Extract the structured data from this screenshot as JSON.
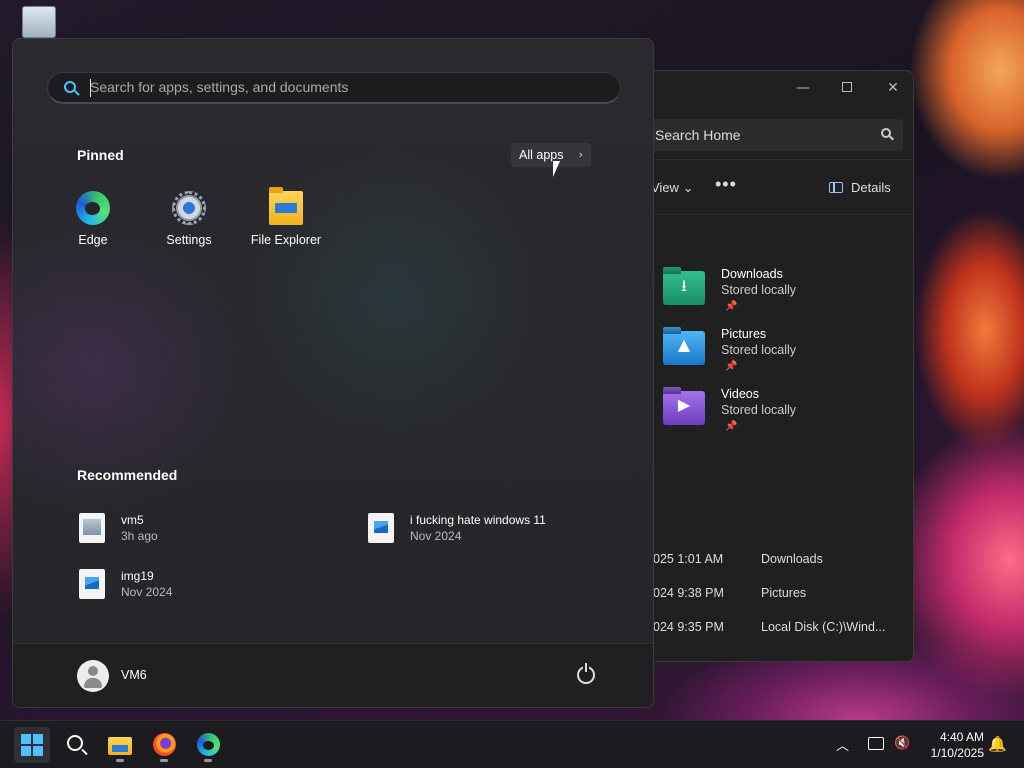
{
  "desktop": {
    "recycle_bin_icon": "recycle-bin-icon"
  },
  "start_menu": {
    "search_placeholder": "Search for apps, settings, and documents",
    "pinned_title": "Pinned",
    "all_apps_label": "All apps",
    "pinned_apps": [
      {
        "label": "Edge",
        "icon": "edge-icon"
      },
      {
        "label": "Settings",
        "icon": "settings-gear-icon"
      },
      {
        "label": "File Explorer",
        "icon": "folder-icon"
      }
    ],
    "recommended_title": "Recommended",
    "recommended": [
      {
        "name": "vm5",
        "time": "3h ago",
        "icon": "vm-file-icon"
      },
      {
        "name": "i fucking hate windows 11",
        "time": "Nov 2024",
        "icon": "image-file-icon"
      },
      {
        "name": "img19",
        "time": "Nov 2024",
        "icon": "image-file-icon"
      }
    ],
    "user_name": "VM6"
  },
  "explorer": {
    "window_controls": {
      "minimize": "—",
      "close": "✕"
    },
    "search_placeholder": "Search Home",
    "toolbar": {
      "view_label": "View",
      "details_label": "Details"
    },
    "quick_access": [
      {
        "name": "Downloads",
        "status": "Stored locally",
        "icon": "downloads-folder-icon",
        "glyph": "⭳"
      },
      {
        "name": "Pictures",
        "status": "Stored locally",
        "icon": "pictures-folder-icon",
        "glyph": "▲"
      },
      {
        "name": "Videos",
        "status": "Stored locally",
        "icon": "videos-folder-icon",
        "glyph": "▶"
      }
    ],
    "recent": [
      {
        "date": "025 1:01 AM",
        "location": "Downloads"
      },
      {
        "date": "024 9:38 PM",
        "location": "Pictures"
      },
      {
        "date": "024 9:35 PM",
        "location": "Local Disk (C:)\\Wind..."
      }
    ]
  },
  "taskbar": {
    "time": "4:40 AM",
    "date": "1/10/2025",
    "accent": "#4cc2ff"
  }
}
